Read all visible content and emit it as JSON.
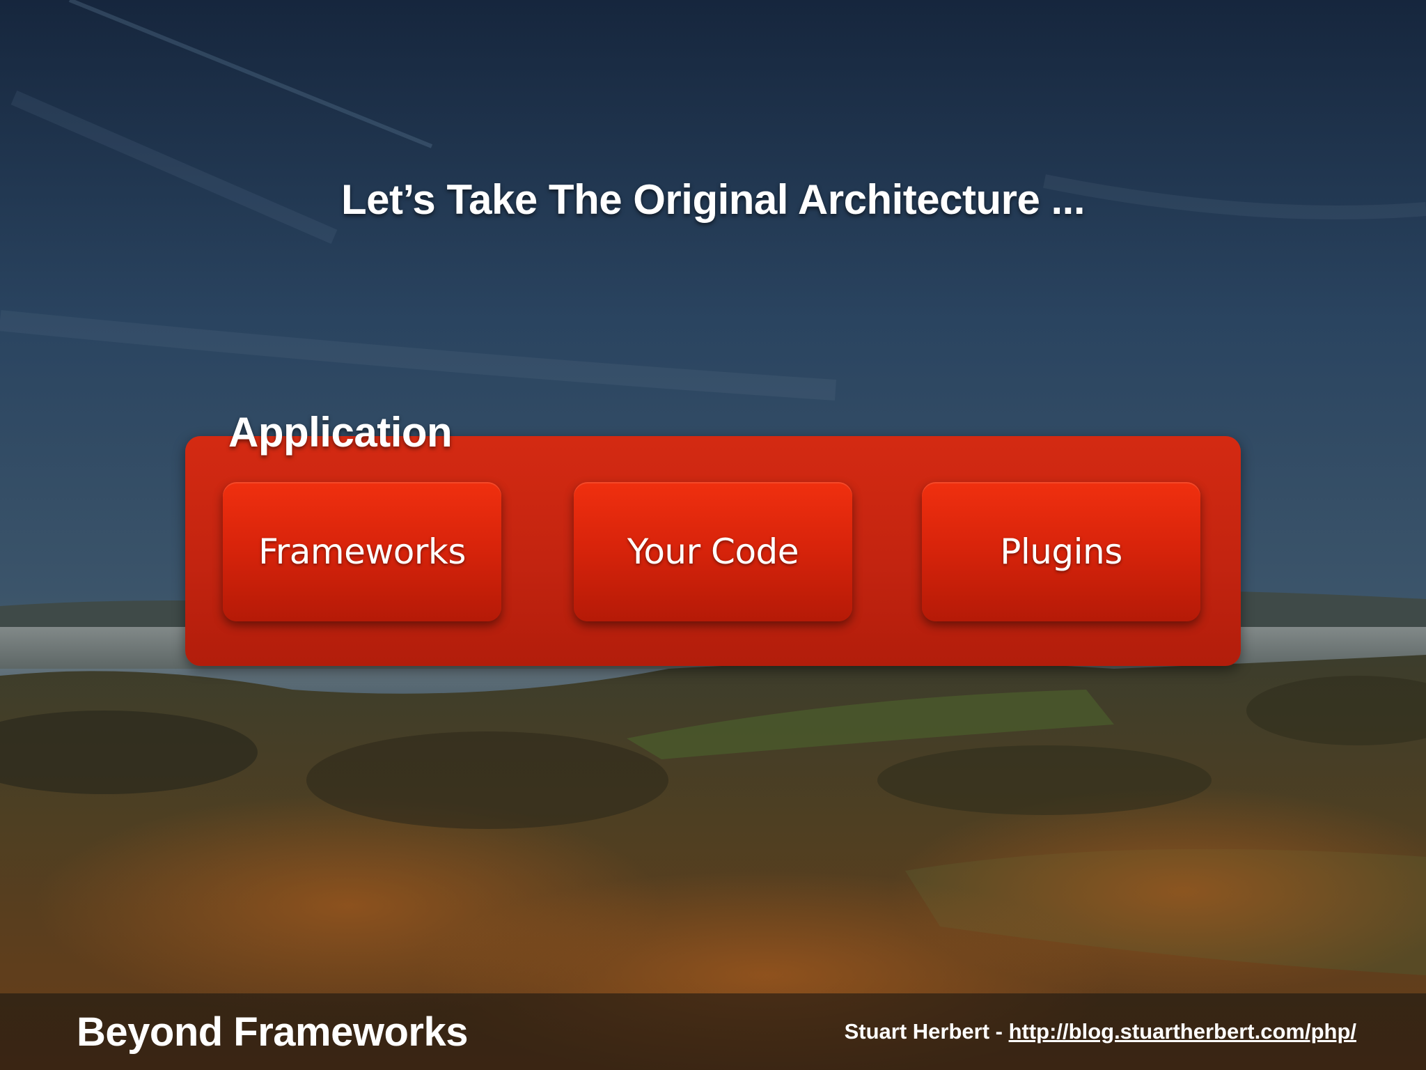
{
  "slide": {
    "title": "Let’s Take The Original Architecture ...",
    "background": "hillside-landscape-photo"
  },
  "diagram": {
    "container_label": "Application",
    "container_color": "#c8260f",
    "components": [
      {
        "label": "Frameworks"
      },
      {
        "label": "Your Code"
      },
      {
        "label": "Plugins"
      }
    ],
    "component_color": "#e02a0d"
  },
  "footer": {
    "title": "Beyond Frameworks",
    "author": "Stuart Herbert -",
    "url": "http://blog.stuartherbert.com/php/"
  }
}
